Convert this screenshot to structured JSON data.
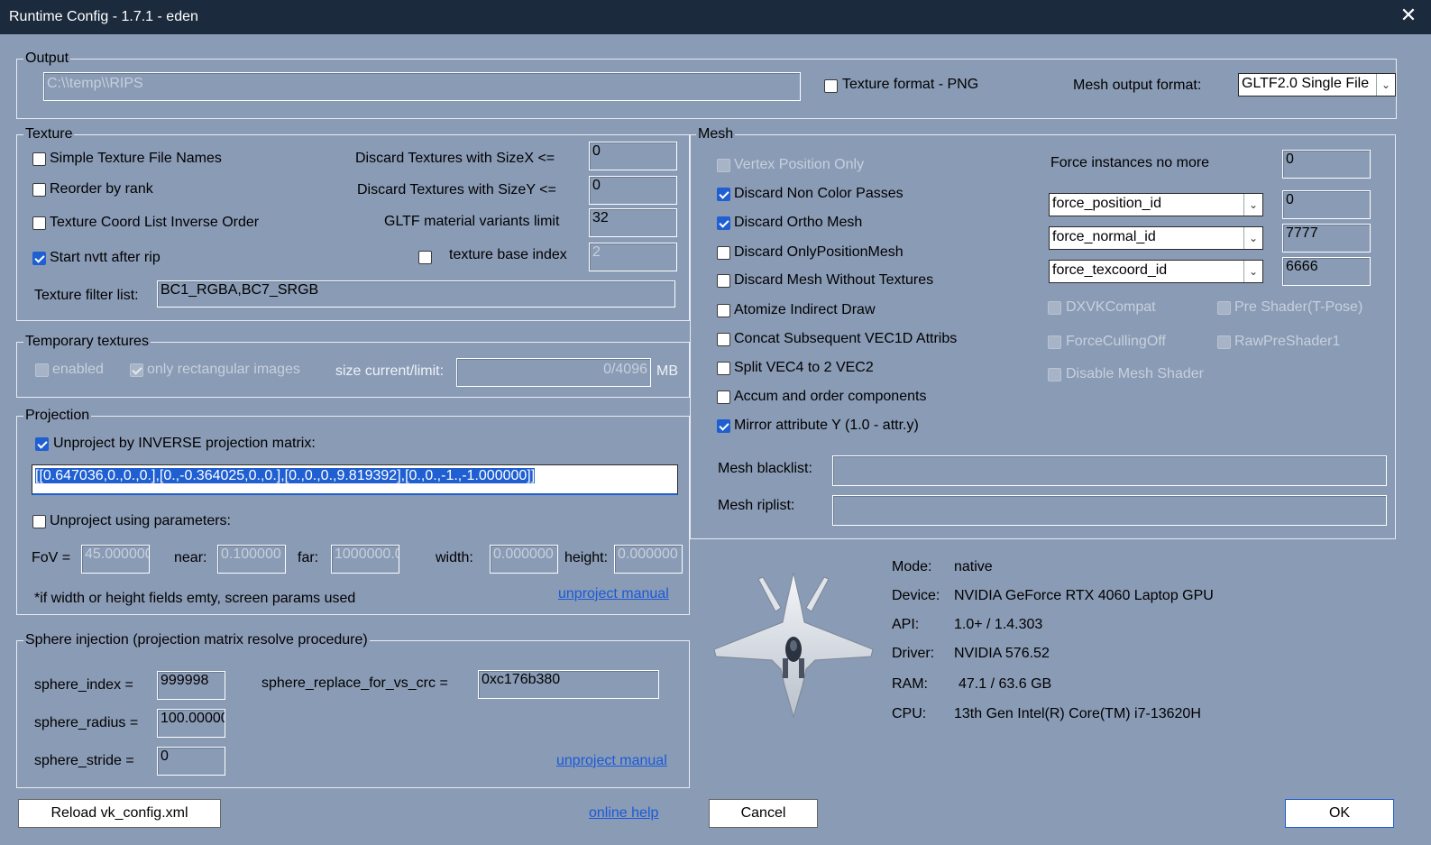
{
  "window": {
    "title": "Runtime Config - 1.7.1 - eden",
    "close_glyph": "✕"
  },
  "output": {
    "group_title": "Output",
    "path_value": "C:\\\\temp\\\\RIPS",
    "texture_png_label": "Texture format - PNG",
    "texture_png_checked": false,
    "mesh_format_label": "Mesh output format:",
    "mesh_format_value": "GLTF2.0 Single File"
  },
  "texture": {
    "group_title": "Texture",
    "simple_names": "Simple Texture File Names",
    "reorder_rank": "Reorder by rank",
    "coord_inverse": "Texture Coord List Inverse Order",
    "start_nvtt": "Start nvtt after rip",
    "discard_x_label": "Discard Textures with SizeX <=",
    "discard_x_value": "0",
    "discard_y_label": "Discard Textures with SizeY <=",
    "discard_y_value": "0",
    "gltf_variants_label": "GLTF material variants limit",
    "gltf_variants_value": "32",
    "base_index_label": "texture base index",
    "base_index_value": "2",
    "filter_label": "Texture filter list:",
    "filter_value": "BC1_RGBA,BC7_SRGB"
  },
  "temporary": {
    "group_title": "Temporary textures",
    "enabled_label": "enabled",
    "rect_label": "only rectangular images",
    "size_label": "size current/limit:",
    "size_value": "0/4096",
    "unit": "MB"
  },
  "projection": {
    "group_title": "Projection",
    "inverse_label": "Unproject by INVERSE projection matrix:",
    "matrix_value": "[[0.647036,0.,0.,0.],[0.,-0.364025,0.,0.],[0.,0.,0.,9.819392],[0.,0.,-1.,-1.000000]]",
    "params_label": "Unproject using parameters:",
    "fov_label": "FoV =",
    "fov_value": "45.000000",
    "near_label": "near:",
    "near_value": "0.100000",
    "far_label": "far:",
    "far_value": "1000000.0",
    "width_label": "width:",
    "width_value": "0.000000",
    "height_label": "height:",
    "height_value": "0.000000",
    "note": "*if width or height fields emty, screen params used",
    "manual_link": "unproject manual"
  },
  "sphere": {
    "group_title": "Sphere injection (projection matrix resolve procedure)",
    "index_label": "sphere_index =",
    "index_value": "999998",
    "replace_label": "sphere_replace_for_vs_crc =",
    "replace_value": "0xc176b380",
    "radius_label": "sphere_radius =",
    "radius_value": "100.000000",
    "stride_label": "sphere_stride =",
    "stride_value": "0",
    "manual_link": "unproject manual"
  },
  "mesh": {
    "group_title": "Mesh",
    "vertex_pos_only": "Vertex Position Only",
    "discard_non_color": "Discard Non Color Passes",
    "discard_ortho": "Discard Ortho Mesh",
    "discard_only_pos": "Discard OnlyPositionMesh",
    "discard_no_tex": "Discard Mesh Without Textures",
    "atomize": "Atomize Indirect Draw",
    "concat": "Concat Subsequent VEC1D Attribs",
    "split": "Split VEC4 to 2 VEC2",
    "accum": "Accum and order components",
    "mirror": "Mirror attribute Y (1.0 - attr.y)",
    "force_instances_label": "Force instances no more",
    "force_instances_value": "0",
    "force_position_select": "force_position_id",
    "force_position_value": "0",
    "force_normal_select": "force_normal_id",
    "force_normal_value": "7777",
    "force_texcoord_select": "force_texcoord_id",
    "force_texcoord_value": "6666",
    "dxvk": "DXVKCompat",
    "pre_shader": "Pre Shader(T-Pose)",
    "force_culling": "ForceCullingOff",
    "raw_pre_shader": "RawPreShader1",
    "disable_mesh_shader": "Disable Mesh Shader",
    "blacklist_label": "Mesh blacklist:",
    "blacklist_value": "",
    "riplist_label": "Mesh riplist:",
    "riplist_value": ""
  },
  "info": {
    "mode_k": "Mode:",
    "mode_v": "native",
    "device_k": "Device:",
    "device_v": "NVIDIA GeForce RTX 4060 Laptop GPU",
    "api_k": "API:",
    "api_v": "1.0+ / 1.4.303",
    "driver_k": "Driver:",
    "driver_v": "NVIDIA 576.52",
    "ram_k": "RAM:",
    "ram_v": "47.1 / 63.6 GB",
    "cpu_k": "CPU:",
    "cpu_v": "13th Gen Intel(R) Core(TM) i7-13620H"
  },
  "footer": {
    "reload": "Reload vk_config.xml",
    "help": "online help",
    "cancel": "Cancel",
    "ok": "OK"
  }
}
